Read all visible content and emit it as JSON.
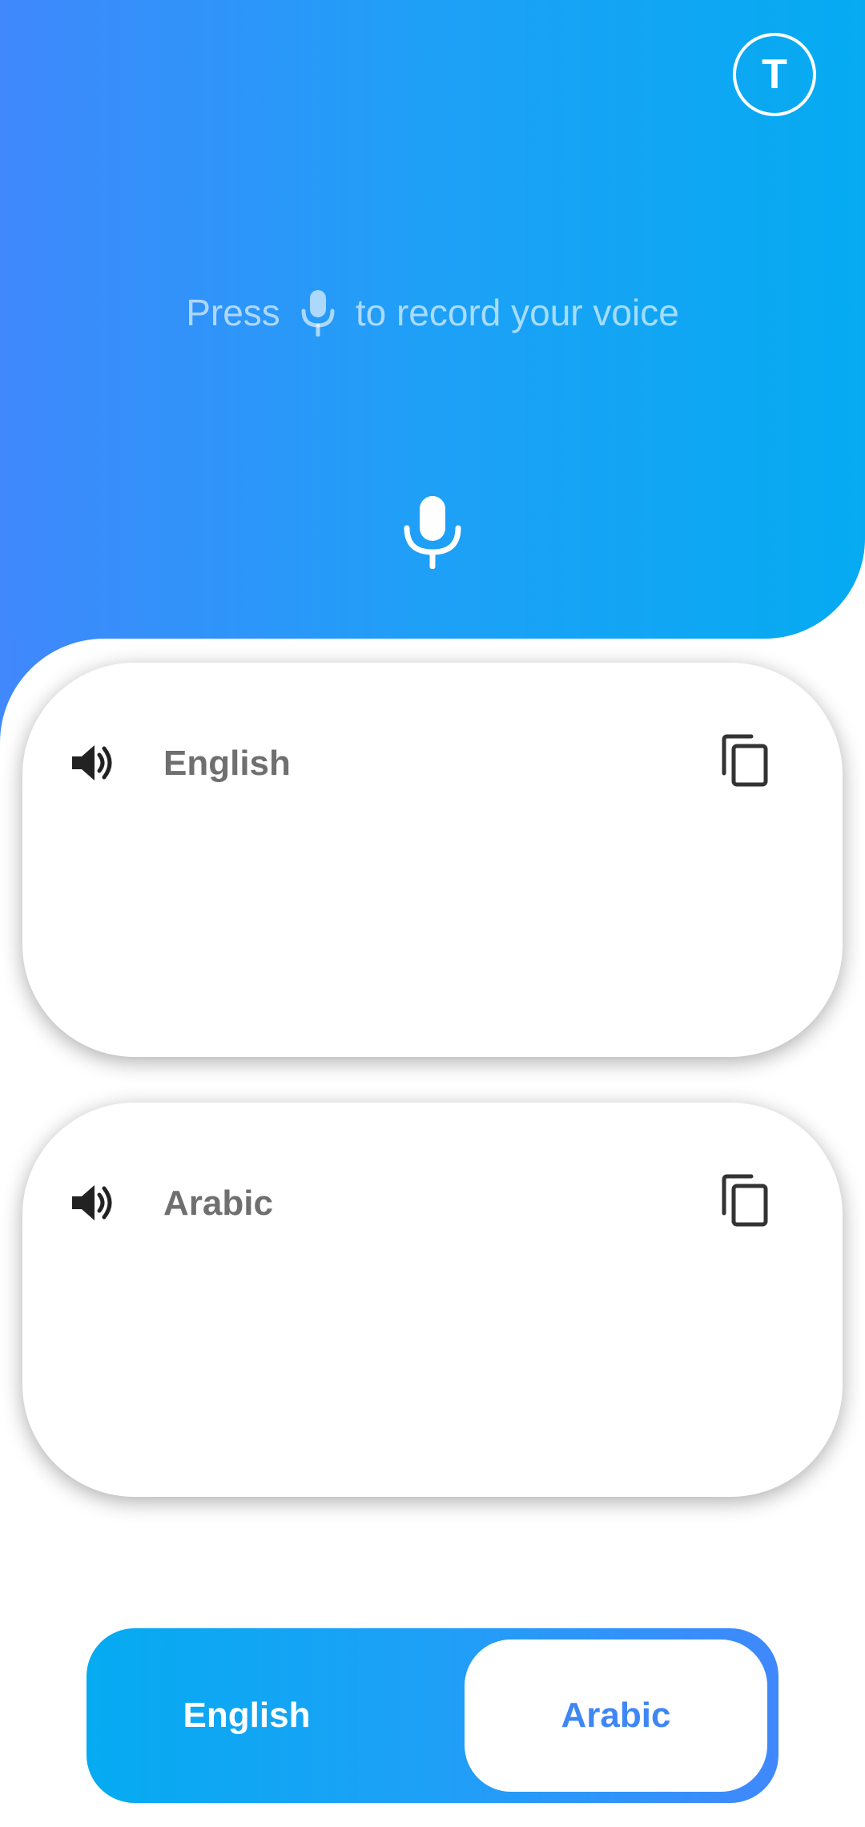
{
  "header": {
    "profile_initial": "T",
    "hint_before": "Press",
    "hint_after": "to record your voice"
  },
  "cards": [
    {
      "language": "English",
      "text": ""
    },
    {
      "language": "Arabic",
      "text": ""
    }
  ],
  "toggle": {
    "left_label": "English",
    "right_label": "Arabic",
    "selected": "Arabic"
  },
  "colors": {
    "gradient_start": "#4088fc",
    "gradient_end": "#05abf1",
    "accent_text": "#3f86f6",
    "label_gray": "#6f6f6f"
  },
  "icons": {
    "profile": "avatar-initial",
    "hint": "microphone-icon",
    "record": "microphone-icon",
    "speak": "speaker-icon",
    "copy": "copy-icon"
  }
}
